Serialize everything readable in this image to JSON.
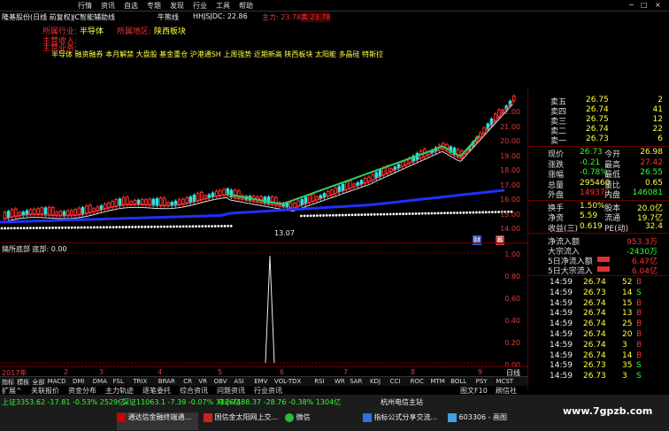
{
  "menu": {
    "items": [
      "行情",
      "资讯",
      "自选",
      "专题",
      "发现",
      "行业",
      "工具",
      "帮助"
    ],
    "window_controls": [
      "−",
      "□",
      "×"
    ]
  },
  "titlebar": {
    "stock": "隆基股份(日线 前复权)",
    "indicator": "JC智能辅助线",
    "mid_label": "牛熊线",
    "hhjsjdc": "HHJSJDC: 22.86",
    "main": "主力: 23.78",
    "badge": "卖 23.78"
  },
  "info": {
    "industry_label": "所属行业:",
    "industry_value": "半导体",
    "region_label": "所属地区:",
    "region_value": "陕西板块",
    "line3": "主营收入:",
    "line4": "主营业务:",
    "concepts": "半导体 融资融券 本月解禁 大盘股 基金重仓 沪港通SH 上周强势 近期新高 陕西板块 太阳能 多晶硅 特斯拉"
  },
  "chart": {
    "yticks": [
      "22.00",
      "21.00",
      "20.00",
      "19.00",
      "18.00",
      "17.00",
      "16.00",
      "15.00",
      "14.00"
    ],
    "low_marker": "13.07",
    "marker_cai": "财",
    "marker_jie": "蓄"
  },
  "subchart": {
    "title": "搞所底部 底部: 0.00",
    "yticks": [
      "1.00",
      "0.80",
      "0.60",
      "0.40",
      "0.20",
      "0.00"
    ]
  },
  "xaxis": {
    "labels": [
      "2017年",
      "2",
      "3",
      "4",
      "5",
      "6",
      "7",
      "8",
      "9"
    ],
    "right_label": "日线"
  },
  "indicator_tabs": [
    "指标",
    "模板",
    "全部",
    "MACD",
    "DMI",
    "DMA",
    "FSL",
    "TRIX",
    "BRAR",
    "CR",
    "VR",
    "OBV",
    "ASI",
    "EMV",
    "VOL-TDX",
    "RSI",
    "WR",
    "SAR",
    "KDJ",
    "CCI",
    "ROC",
    "MTM",
    "BOLL",
    "PSY",
    "MCST"
  ],
  "bottom_tabs": [
    "扩展^",
    "关联报价",
    "资金分布",
    "主力轨迹",
    "逐笔委托",
    "综合资讯",
    "问题资讯",
    "行业资讯"
  ],
  "bottom_right": [
    "图文F10",
    "刷信社"
  ],
  "order_book": {
    "asks": [
      {
        "label": "卖五",
        "price": "26.75",
        "vol": "2"
      },
      {
        "label": "卖四",
        "price": "26.74",
        "vol": "41"
      },
      {
        "label": "卖三",
        "price": "26.75",
        "vol": "12"
      },
      {
        "label": "卖二",
        "price": "26.74",
        "vol": "22"
      },
      {
        "label": "卖一",
        "price": "26.73",
        "vol": "6"
      }
    ],
    "bids": [
      {
        "label": "买一",
        "price": "26.75",
        "vol": "12"
      },
      {
        "label": "买二",
        "price": "26.74",
        "vol": "41"
      },
      {
        "label": "买三",
        "price": "26.73",
        "vol": "2"
      },
      {
        "label": "买四",
        "price": "26.72",
        "vol": "7"
      },
      {
        "label": "买五",
        "price": "26.71",
        "vol": "16"
      }
    ]
  },
  "quote": [
    {
      "l1": "现价",
      "v1": "26.73",
      "l2": "今开",
      "v2": "26.98"
    },
    {
      "l1": "涨跌",
      "v1": "-0.21",
      "l2": "最高",
      "v2": "27.42"
    },
    {
      "l1": "涨幅",
      "v1": "-0.78%",
      "l2": "最低",
      "v2": "26.55"
    },
    {
      "l1": "总量",
      "v1": "295460",
      "l2": "量比",
      "v2": "0.65"
    },
    {
      "l1": "外盘",
      "v1": "149379",
      "l2": "内盘",
      "v2": "146081"
    },
    {
      "l1": "换手",
      "v1": "1.50%",
      "l2": "股本",
      "v2": "20.0亿"
    },
    {
      "l1": "净资",
      "v1": "5.59",
      "l2": "流通",
      "v2": "19.7亿"
    },
    {
      "l1": "收益(三)",
      "v1": "0.619",
      "l2": "PE(动)",
      "v2": "32.4"
    }
  ],
  "flow": [
    {
      "label": "净流入额",
      "value": "953.3万"
    },
    {
      "label": "大宗流入",
      "value": "-2430万"
    },
    {
      "label": "5日净流入额",
      "value": "6.47亿"
    },
    {
      "label": "5日大宗流入",
      "value": "6.04亿"
    }
  ],
  "ticks": [
    {
      "time": "14:59",
      "price": "26.74",
      "vol": "52",
      "side": "B"
    },
    {
      "time": "14:59",
      "price": "26.73",
      "vol": "14",
      "side": "S"
    },
    {
      "time": "14:59",
      "price": "26.74",
      "vol": "15",
      "side": "B"
    },
    {
      "time": "14:59",
      "price": "26.74",
      "vol": "13",
      "side": "B"
    },
    {
      "time": "14:59",
      "price": "26.74",
      "vol": "25",
      "side": "B"
    },
    {
      "time": "14:59",
      "price": "26.74",
      "vol": "20",
      "side": "B"
    },
    {
      "time": "14:59",
      "price": "26.74",
      "vol": "3",
      "side": "B"
    },
    {
      "time": "14:59",
      "price": "26.74",
      "vol": "14",
      "side": "B"
    },
    {
      "time": "14:59",
      "price": "26.73",
      "vol": "35",
      "side": "S"
    },
    {
      "time": "14:59",
      "price": "26.73",
      "vol": "3",
      "side": "S"
    },
    {
      "time": "14:59",
      "price": "26.73",
      "vol": "3",
      "side": "S"
    }
  ],
  "status": {
    "sh": "上证3353.62  -17.81  -0.53%  2529亿",
    "sz": "深证11063.1  -7.39  -0.07%  3126亿",
    "zx": "中小7488.37  -28.76  -0.38%  1304亿",
    "right": "杭州电信主站"
  },
  "taskbar": {
    "items": [
      "通达信金融终端通...",
      "国信金太阳网上交...",
      "微信",
      "指标公式分享交流...",
      "603306 - 画图"
    ]
  },
  "watermark": "www.7gpzb.com"
}
